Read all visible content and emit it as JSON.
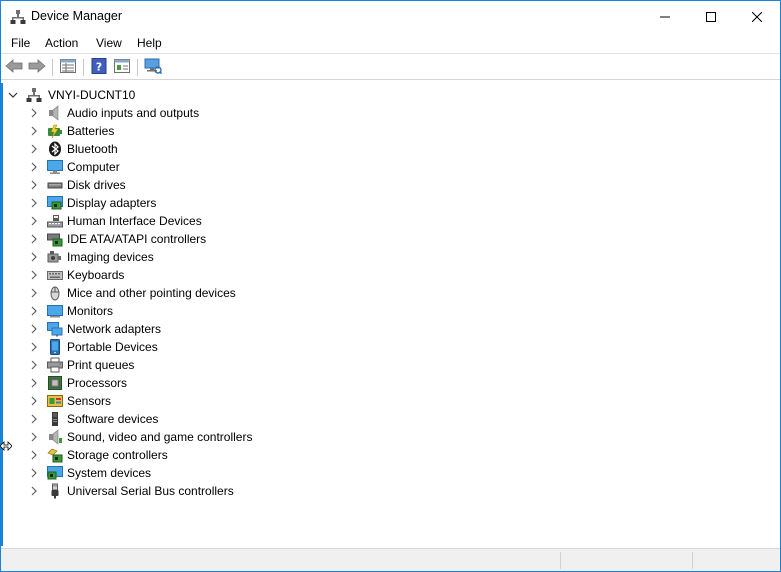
{
  "window": {
    "title": "Device Manager",
    "minimize_icon": "minimize-icon",
    "maximize_icon": "maximize-icon",
    "close_icon": "close-icon"
  },
  "menu": [
    "File",
    "Action",
    "View",
    "Help"
  ],
  "toolbar": {
    "buttons": [
      "back-arrow-icon",
      "forward-arrow-icon",
      "properties-grid-icon",
      "help-icon",
      "update-driver-icon",
      "scan-hardware-icon"
    ]
  },
  "tree": {
    "root": "VNYI-DUCNT10",
    "categories": [
      {
        "label": "Audio inputs and outputs",
        "icon": "speaker-icon"
      },
      {
        "label": "Batteries",
        "icon": "battery-icon"
      },
      {
        "label": "Bluetooth",
        "icon": "bluetooth-icon"
      },
      {
        "label": "Computer",
        "icon": "computer-monitor-icon"
      },
      {
        "label": "Disk drives",
        "icon": "disk-drive-icon"
      },
      {
        "label": "Display adapters",
        "icon": "display-adapter-icon"
      },
      {
        "label": "Human Interface Devices",
        "icon": "hid-icon"
      },
      {
        "label": "IDE ATA/ATAPI controllers",
        "icon": "ide-controller-icon"
      },
      {
        "label": "Imaging devices",
        "icon": "camera-icon"
      },
      {
        "label": "Keyboards",
        "icon": "keyboard-icon"
      },
      {
        "label": "Mice and other pointing devices",
        "icon": "mouse-icon"
      },
      {
        "label": "Monitors",
        "icon": "monitor-icon"
      },
      {
        "label": "Network adapters",
        "icon": "network-adapter-icon"
      },
      {
        "label": "Portable Devices",
        "icon": "portable-device-icon"
      },
      {
        "label": "Print queues",
        "icon": "printer-icon"
      },
      {
        "label": "Processors",
        "icon": "processor-icon"
      },
      {
        "label": "Sensors",
        "icon": "sensor-icon"
      },
      {
        "label": "Software devices",
        "icon": "software-device-icon"
      },
      {
        "label": "Sound, video and game controllers",
        "icon": "sound-icon"
      },
      {
        "label": "Storage controllers",
        "icon": "storage-controller-icon"
      },
      {
        "label": "System devices",
        "icon": "system-device-icon"
      },
      {
        "label": "Universal Serial Bus controllers",
        "icon": "usb-icon"
      }
    ]
  },
  "colors": {
    "window_border": "#1883d7",
    "chevron": "#606060"
  }
}
